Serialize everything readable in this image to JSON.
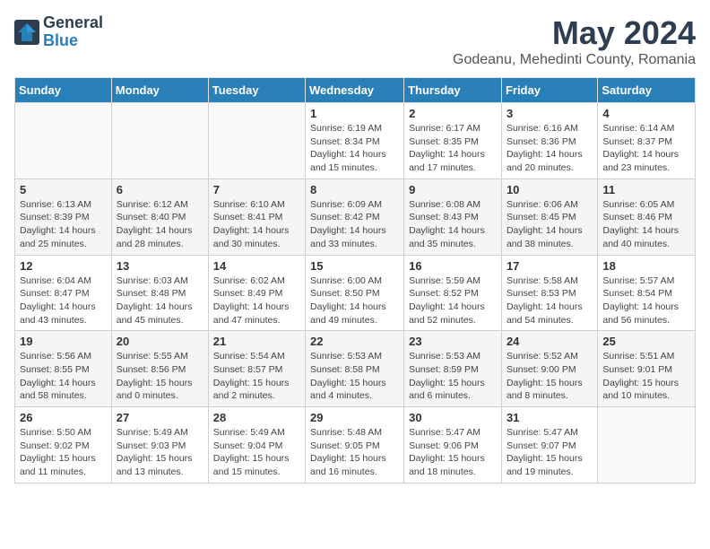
{
  "header": {
    "logo_general": "General",
    "logo_blue": "Blue",
    "month_year": "May 2024",
    "location": "Godeanu, Mehedinti County, Romania"
  },
  "days_of_week": [
    "Sunday",
    "Monday",
    "Tuesday",
    "Wednesday",
    "Thursday",
    "Friday",
    "Saturday"
  ],
  "weeks": [
    [
      {
        "day": "",
        "info": ""
      },
      {
        "day": "",
        "info": ""
      },
      {
        "day": "",
        "info": ""
      },
      {
        "day": "1",
        "info": "Sunrise: 6:19 AM\nSunset: 8:34 PM\nDaylight: 14 hours\nand 15 minutes."
      },
      {
        "day": "2",
        "info": "Sunrise: 6:17 AM\nSunset: 8:35 PM\nDaylight: 14 hours\nand 17 minutes."
      },
      {
        "day": "3",
        "info": "Sunrise: 6:16 AM\nSunset: 8:36 PM\nDaylight: 14 hours\nand 20 minutes."
      },
      {
        "day": "4",
        "info": "Sunrise: 6:14 AM\nSunset: 8:37 PM\nDaylight: 14 hours\nand 23 minutes."
      }
    ],
    [
      {
        "day": "5",
        "info": "Sunrise: 6:13 AM\nSunset: 8:39 PM\nDaylight: 14 hours\nand 25 minutes."
      },
      {
        "day": "6",
        "info": "Sunrise: 6:12 AM\nSunset: 8:40 PM\nDaylight: 14 hours\nand 28 minutes."
      },
      {
        "day": "7",
        "info": "Sunrise: 6:10 AM\nSunset: 8:41 PM\nDaylight: 14 hours\nand 30 minutes."
      },
      {
        "day": "8",
        "info": "Sunrise: 6:09 AM\nSunset: 8:42 PM\nDaylight: 14 hours\nand 33 minutes."
      },
      {
        "day": "9",
        "info": "Sunrise: 6:08 AM\nSunset: 8:43 PM\nDaylight: 14 hours\nand 35 minutes."
      },
      {
        "day": "10",
        "info": "Sunrise: 6:06 AM\nSunset: 8:45 PM\nDaylight: 14 hours\nand 38 minutes."
      },
      {
        "day": "11",
        "info": "Sunrise: 6:05 AM\nSunset: 8:46 PM\nDaylight: 14 hours\nand 40 minutes."
      }
    ],
    [
      {
        "day": "12",
        "info": "Sunrise: 6:04 AM\nSunset: 8:47 PM\nDaylight: 14 hours\nand 43 minutes."
      },
      {
        "day": "13",
        "info": "Sunrise: 6:03 AM\nSunset: 8:48 PM\nDaylight: 14 hours\nand 45 minutes."
      },
      {
        "day": "14",
        "info": "Sunrise: 6:02 AM\nSunset: 8:49 PM\nDaylight: 14 hours\nand 47 minutes."
      },
      {
        "day": "15",
        "info": "Sunrise: 6:00 AM\nSunset: 8:50 PM\nDaylight: 14 hours\nand 49 minutes."
      },
      {
        "day": "16",
        "info": "Sunrise: 5:59 AM\nSunset: 8:52 PM\nDaylight: 14 hours\nand 52 minutes."
      },
      {
        "day": "17",
        "info": "Sunrise: 5:58 AM\nSunset: 8:53 PM\nDaylight: 14 hours\nand 54 minutes."
      },
      {
        "day": "18",
        "info": "Sunrise: 5:57 AM\nSunset: 8:54 PM\nDaylight: 14 hours\nand 56 minutes."
      }
    ],
    [
      {
        "day": "19",
        "info": "Sunrise: 5:56 AM\nSunset: 8:55 PM\nDaylight: 14 hours\nand 58 minutes."
      },
      {
        "day": "20",
        "info": "Sunrise: 5:55 AM\nSunset: 8:56 PM\nDaylight: 15 hours\nand 0 minutes."
      },
      {
        "day": "21",
        "info": "Sunrise: 5:54 AM\nSunset: 8:57 PM\nDaylight: 15 hours\nand 2 minutes."
      },
      {
        "day": "22",
        "info": "Sunrise: 5:53 AM\nSunset: 8:58 PM\nDaylight: 15 hours\nand 4 minutes."
      },
      {
        "day": "23",
        "info": "Sunrise: 5:53 AM\nSunset: 8:59 PM\nDaylight: 15 hours\nand 6 minutes."
      },
      {
        "day": "24",
        "info": "Sunrise: 5:52 AM\nSunset: 9:00 PM\nDaylight: 15 hours\nand 8 minutes."
      },
      {
        "day": "25",
        "info": "Sunrise: 5:51 AM\nSunset: 9:01 PM\nDaylight: 15 hours\nand 10 minutes."
      }
    ],
    [
      {
        "day": "26",
        "info": "Sunrise: 5:50 AM\nSunset: 9:02 PM\nDaylight: 15 hours\nand 11 minutes."
      },
      {
        "day": "27",
        "info": "Sunrise: 5:49 AM\nSunset: 9:03 PM\nDaylight: 15 hours\nand 13 minutes."
      },
      {
        "day": "28",
        "info": "Sunrise: 5:49 AM\nSunset: 9:04 PM\nDaylight: 15 hours\nand 15 minutes."
      },
      {
        "day": "29",
        "info": "Sunrise: 5:48 AM\nSunset: 9:05 PM\nDaylight: 15 hours\nand 16 minutes."
      },
      {
        "day": "30",
        "info": "Sunrise: 5:47 AM\nSunset: 9:06 PM\nDaylight: 15 hours\nand 18 minutes."
      },
      {
        "day": "31",
        "info": "Sunrise: 5:47 AM\nSunset: 9:07 PM\nDaylight: 15 hours\nand 19 minutes."
      },
      {
        "day": "",
        "info": ""
      }
    ]
  ]
}
